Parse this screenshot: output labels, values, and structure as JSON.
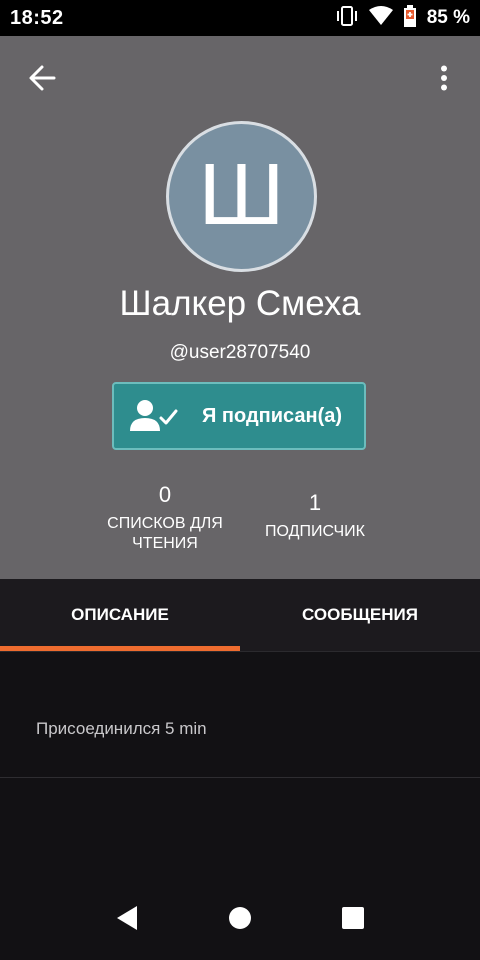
{
  "status_bar": {
    "time": "18:52",
    "battery_text": "85 %"
  },
  "toolbar": {
    "back_icon": "arrow-left-icon",
    "more_icon": "more-vertical-icon"
  },
  "profile": {
    "avatar_letter": "Ш",
    "name": "Шалкер Смеха",
    "handle": "@user28707540",
    "follow_button_label": "Я подписан(а)",
    "stats": {
      "reading_lists": {
        "count": "0",
        "label_line1": "СПИСКОВ ДЛЯ",
        "label_line2": "ЧТЕНИЯ"
      },
      "followers": {
        "count": "1",
        "label": "ПОДПИСЧИК"
      }
    }
  },
  "tabs": [
    {
      "label": "ОПИСАНИЕ",
      "active": true
    },
    {
      "label": "СООБЩЕНИЯ",
      "active": false
    }
  ],
  "about": {
    "joined_text": "Присоединился 5 min"
  },
  "colors": {
    "header_bg": "#676568",
    "follow_button": "#2e8d8e",
    "tab_indicator": "#ee6c2f",
    "avatar_bg": "#7990a1"
  }
}
